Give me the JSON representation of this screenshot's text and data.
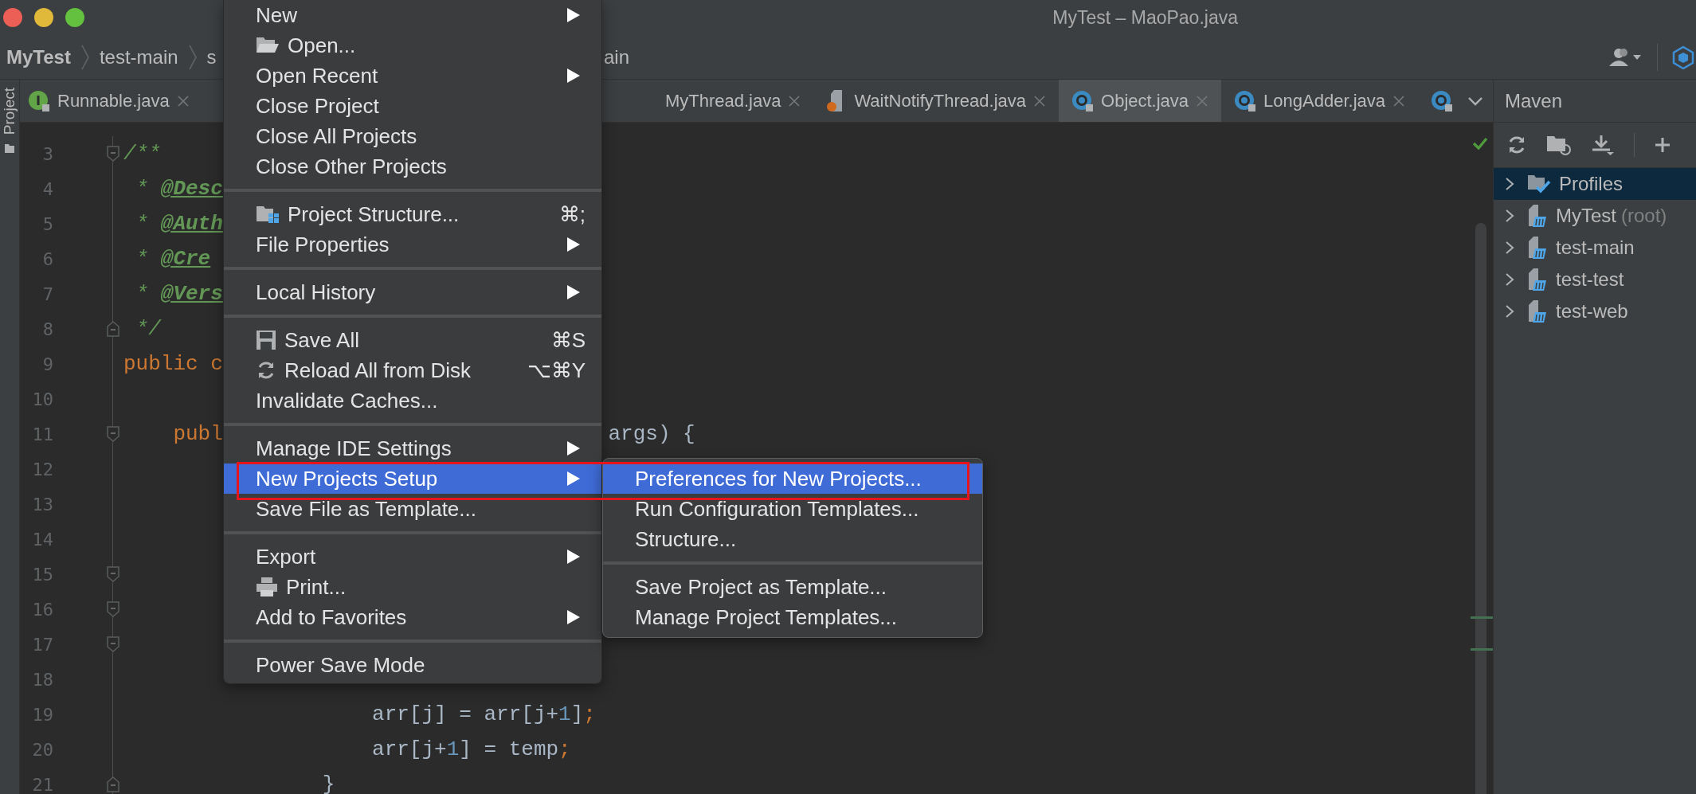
{
  "window": {
    "title": "MyTest – MaoPao.java"
  },
  "breadcrumbs": [
    {
      "label": "MyTest"
    },
    {
      "label": "test-main"
    },
    {
      "label": "s"
    },
    {
      "label": "ain"
    }
  ],
  "tool_strip": {
    "label": "Project"
  },
  "tabs": [
    {
      "label": "Runnable.java",
      "kind": "interface",
      "selected": false
    },
    {
      "label": "MyThread.java",
      "kind": "plain",
      "selected": false
    },
    {
      "label": "WaitNotifyThread.java",
      "kind": "java",
      "selected": false
    },
    {
      "label": "Object.java",
      "kind": "class",
      "selected": true
    },
    {
      "label": "LongAdder.java",
      "kind": "class",
      "selected": false
    },
    {
      "kind": "class",
      "selected": false
    }
  ],
  "editor": {
    "lines": [
      {
        "number": "3",
        "kind": "fold-start",
        "code": [
          {
            "kind": "comment",
            "text": "/**"
          }
        ]
      },
      {
        "number": "4",
        "kind": "plain",
        "code": [
          {
            "kind": "comment",
            "text": " * "
          },
          {
            "kind": "doctag",
            "text": "@Desc"
          }
        ]
      },
      {
        "number": "5",
        "kind": "plain",
        "code": [
          {
            "kind": "comment",
            "text": " * "
          },
          {
            "kind": "doctag",
            "text": "@Auth"
          }
        ]
      },
      {
        "number": "6",
        "kind": "plain",
        "code": [
          {
            "kind": "comment",
            "text": " * "
          },
          {
            "kind": "doctag",
            "text": "@Cre"
          }
        ]
      },
      {
        "number": "7",
        "kind": "plain",
        "code": [
          {
            "kind": "comment",
            "text": " * "
          },
          {
            "kind": "doctag",
            "text": "@Vers"
          }
        ]
      },
      {
        "number": "8",
        "kind": "fold-end",
        "code": [
          {
            "kind": "comment",
            "text": " */"
          }
        ]
      },
      {
        "number": "9",
        "kind": "plain",
        "code": [
          {
            "kind": "keyword",
            "text": "public c"
          }
        ]
      },
      {
        "number": "10",
        "kind": "plain"
      },
      {
        "number": "11",
        "kind": "fold-start",
        "code": [
          {
            "kind": "keyword",
            "text": "    publ"
          }
        ],
        "tail": [
          {
            "kind": "plain",
            "text": "args) {"
          }
        ]
      },
      {
        "number": "12",
        "kind": "plain"
      },
      {
        "number": "13",
        "kind": "plain"
      },
      {
        "number": "14",
        "kind": "plain"
      },
      {
        "number": "15",
        "kind": "fold-start"
      },
      {
        "number": "16",
        "kind": "fold-start"
      },
      {
        "number": "17",
        "kind": "fold-start"
      },
      {
        "number": "18",
        "kind": "plain"
      },
      {
        "number": "19",
        "kind": "plain",
        "code": [
          {
            "kind": "plain",
            "text": "                    arr[j] = arr[j+"
          },
          {
            "kind": "number",
            "text": "1"
          },
          {
            "kind": "plain",
            "text": "]"
          },
          {
            "kind": "keyword",
            "text": ";"
          }
        ]
      },
      {
        "number": "20",
        "kind": "plain",
        "code": [
          {
            "kind": "plain",
            "text": "                    arr[j+"
          },
          {
            "kind": "number",
            "text": "1"
          },
          {
            "kind": "plain",
            "text": "] = temp"
          },
          {
            "kind": "keyword",
            "text": ";"
          }
        ]
      },
      {
        "number": "21",
        "kind": "fold-end",
        "code": [
          {
            "kind": "plain",
            "text": "                }"
          }
        ]
      }
    ]
  },
  "menu": {
    "items": [
      {
        "kind": "plain",
        "label": "New",
        "submenu": true,
        "selected": false
      },
      {
        "kind": "folder",
        "label": "Open...",
        "submenu": false,
        "selected": false
      },
      {
        "kind": "plain",
        "label": "Open Recent",
        "submenu": true,
        "selected": false
      },
      {
        "kind": "plain",
        "label": "Close Project",
        "submenu": false,
        "selected": false
      },
      {
        "kind": "plain",
        "label": "Close All Projects",
        "submenu": false,
        "selected": false
      },
      {
        "kind": "plain",
        "label": "Close Other Projects",
        "submenu": false,
        "selected": false
      },
      {
        "kind": "separator"
      },
      {
        "kind": "structure",
        "label": "Project Structure...",
        "shortcut": "⌘;",
        "submenu": false,
        "selected": false
      },
      {
        "kind": "plain",
        "label": "File Properties",
        "submenu": true,
        "selected": false
      },
      {
        "kind": "separator"
      },
      {
        "kind": "plain",
        "label": "Local History",
        "submenu": true,
        "selected": false
      },
      {
        "kind": "separator"
      },
      {
        "kind": "save",
        "label": "Save All",
        "shortcut": "⌘S",
        "submenu": false,
        "selected": false
      },
      {
        "kind": "reload",
        "label": "Reload All from Disk",
        "shortcut": "⌥⌘Y",
        "submenu": false,
        "selected": false
      },
      {
        "kind": "plain",
        "label": "Invalidate Caches...",
        "submenu": false,
        "selected": false
      },
      {
        "kind": "separator"
      },
      {
        "kind": "plain",
        "label": "Manage IDE Settings",
        "submenu": true,
        "selected": false
      },
      {
        "kind": "plain",
        "label": "New Projects Setup",
        "submenu": true,
        "selected": true
      },
      {
        "kind": "plain",
        "label": "Save File as Template...",
        "submenu": false,
        "selected": false
      },
      {
        "kind": "separator"
      },
      {
        "kind": "plain",
        "label": "Export",
        "submenu": true,
        "selected": false
      },
      {
        "kind": "print",
        "label": "Print...",
        "submenu": false,
        "selected": false
      },
      {
        "kind": "plain",
        "label": "Add to Favorites",
        "submenu": true,
        "selected": false
      },
      {
        "kind": "separator"
      },
      {
        "kind": "plain",
        "label": "Power Save Mode",
        "submenu": false,
        "selected": false
      }
    ]
  },
  "submenu": {
    "items": [
      {
        "kind": "plain",
        "label": "Preferences for New Projects...",
        "selected": true
      },
      {
        "kind": "plain",
        "label": "Run Configuration Templates...",
        "selected": false
      },
      {
        "kind": "plain",
        "label": "Structure...",
        "selected": false
      },
      {
        "kind": "separator"
      },
      {
        "kind": "plain",
        "label": "Save Project as Template...",
        "selected": false
      },
      {
        "kind": "plain",
        "label": "Manage Project Templates...",
        "selected": false
      }
    ]
  },
  "maven": {
    "title": "Maven",
    "tree": [
      {
        "label": "Profiles",
        "kind": "profiles",
        "expanded": false,
        "selected": true
      },
      {
        "label": "MyTest",
        "suffix": "(root)",
        "kind": "module",
        "expanded": false,
        "selected": false
      },
      {
        "label": "test-main",
        "kind": "module",
        "expanded": false,
        "selected": false
      },
      {
        "label": "test-test",
        "kind": "module",
        "expanded": false,
        "selected": false
      },
      {
        "label": "test-web",
        "kind": "module",
        "expanded": false,
        "selected": false
      }
    ]
  }
}
